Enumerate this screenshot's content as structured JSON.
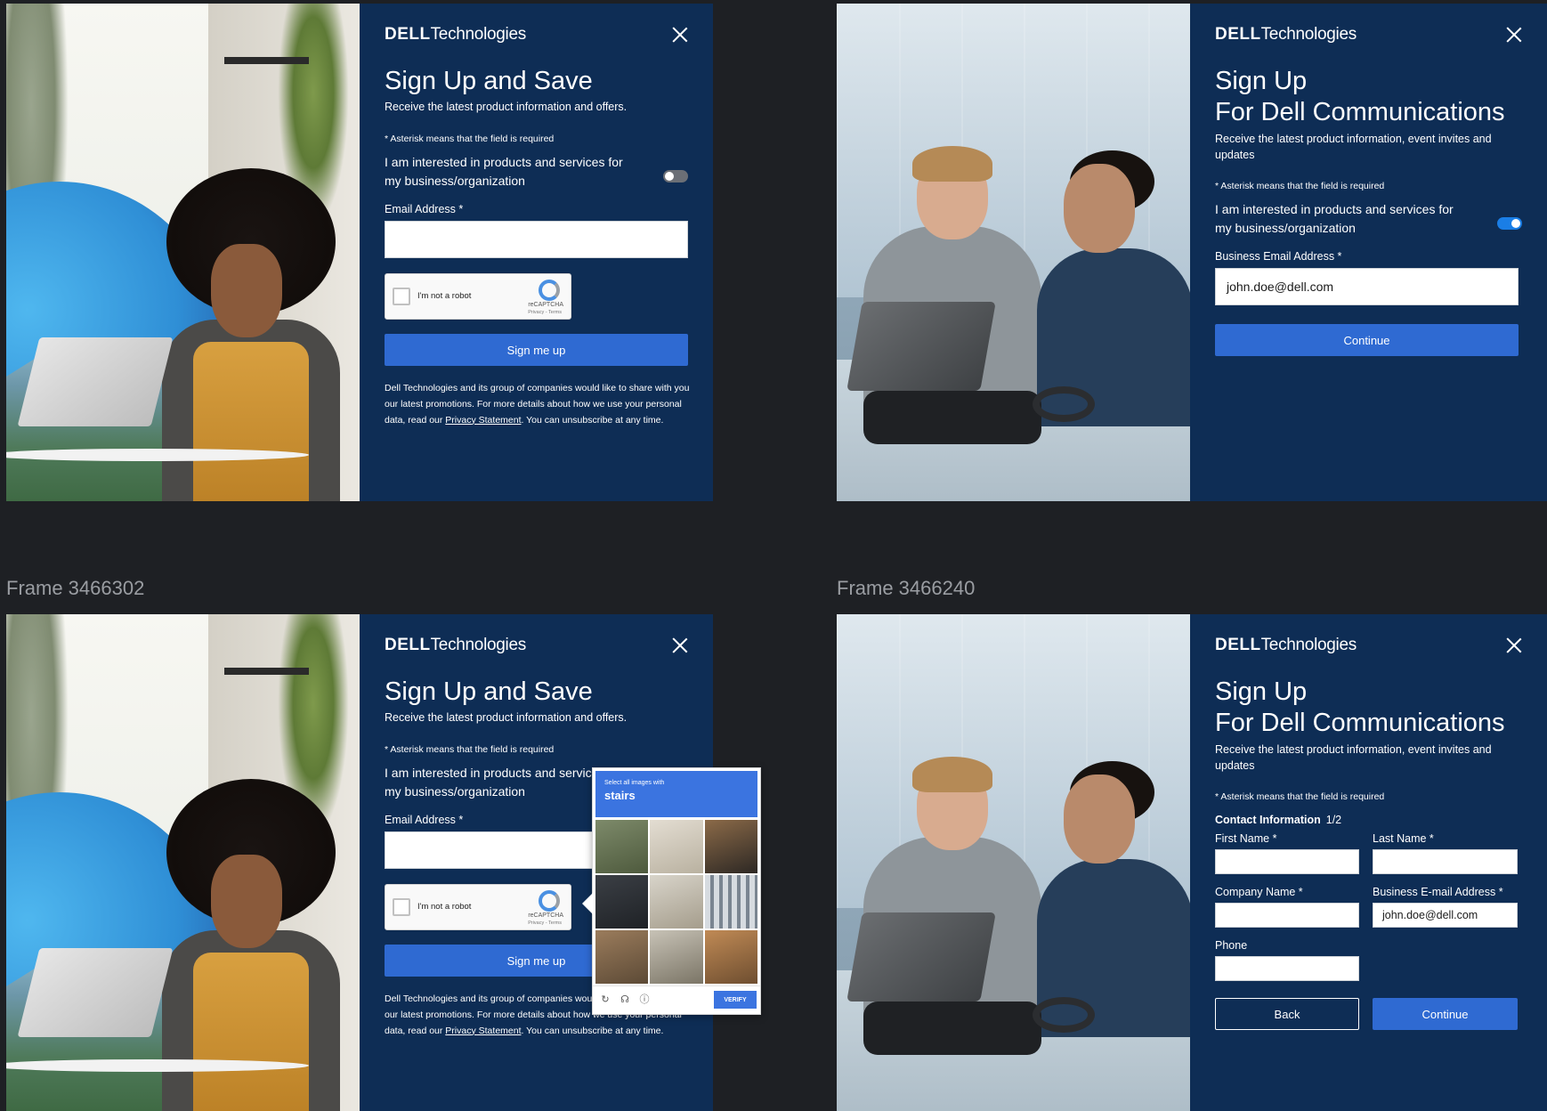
{
  "frame_labels": {
    "bottom_left": "Frame 3466302",
    "bottom_right": "Frame 3466240"
  },
  "brand": {
    "dell": "DELL",
    "technologies": "Technologies"
  },
  "colors": {
    "modal_bg": "#0e2d55",
    "primary_button": "#2f6ad2",
    "toggle_on": "#1a7ee6"
  },
  "icons": {
    "close": "close-icon",
    "recaptcha": "recaptcha-icon",
    "reload": "reload-icon",
    "audio": "audio-icon",
    "info": "info-icon"
  },
  "save_form": {
    "title": "Sign Up and Save",
    "subtitle": "Receive the latest product information and offers.",
    "asterisk_note": "* Asterisk means that the field is required",
    "interest_text": "I am interested in products and services for my business/organization",
    "interest_toggle": "off",
    "email_label": "Email Address *",
    "email_value": "",
    "captcha_label": "I'm not a robot",
    "captcha_brand": "reCAPTCHA",
    "captcha_terms": "Privacy - Terms",
    "submit": "Sign me up",
    "legal_before": "Dell Technologies and its group of companies would like to share with you our latest promotions.  For more details about how we use your personal data, read our ",
    "legal_link": "Privacy Statement",
    "legal_after": ".  You can unsubscribe at any time."
  },
  "comms_form": {
    "title_line1": "Sign Up",
    "title_line2": "For Dell Communications",
    "subtitle": "Receive the latest product information, event invites and updates",
    "asterisk_note": "* Asterisk means that the field is required",
    "interest_text": "I am interested in products and services for my business/organization",
    "interest_toggle": "on",
    "business_email_label": "Business Email Address *",
    "business_email_value": "john.doe@dell.com",
    "continue": "Continue"
  },
  "challenge": {
    "instruction": "Select all images with",
    "keyword": "stairs",
    "verify": "VERIFY"
  },
  "contact_form": {
    "section": "Contact Information",
    "step": "1/2",
    "first_name_label": "First Name *",
    "last_name_label": "Last Name *",
    "company_label": "Company Name *",
    "business_email_label": "Business E-mail Address *",
    "business_email_value": "john.doe@dell.com",
    "phone_label": "Phone",
    "back": "Back",
    "continue": "Continue"
  }
}
